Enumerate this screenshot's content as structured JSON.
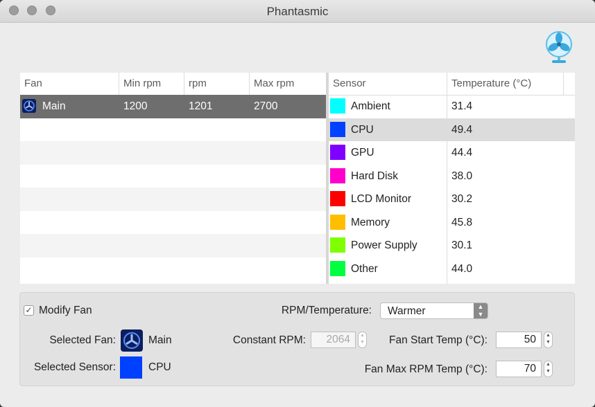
{
  "window": {
    "title": "Phantasmic"
  },
  "fan_table": {
    "columns": [
      "Fan",
      "Min rpm",
      "rpm",
      "Max rpm"
    ],
    "rows": [
      {
        "name": "Main",
        "min_rpm": "1200",
        "rpm": "1201",
        "max_rpm": "2700"
      }
    ]
  },
  "sensor_table": {
    "columns": [
      "Sensor",
      "Temperature (°C)"
    ],
    "rows": [
      {
        "name": "Ambient",
        "temp": "31.4",
        "color": "#00ffff"
      },
      {
        "name": "CPU",
        "temp": "49.4",
        "color": "#0040ff"
      },
      {
        "name": "GPU",
        "temp": "44.4",
        "color": "#8000ff"
      },
      {
        "name": "Hard Disk",
        "temp": "38.0",
        "color": "#ff00cc"
      },
      {
        "name": "LCD Monitor",
        "temp": "30.2",
        "color": "#ff0000"
      },
      {
        "name": "Memory",
        "temp": "45.8",
        "color": "#ffbf00"
      },
      {
        "name": "Power Supply",
        "temp": "30.1",
        "color": "#80ff00"
      },
      {
        "name": "Other",
        "temp": "44.0",
        "color": "#00ff40"
      }
    ]
  },
  "controls": {
    "modify_fan_label": "Modify Fan",
    "modify_fan_checked": true,
    "selected_fan_label": "Selected Fan:",
    "selected_fan_value": "Main",
    "selected_sensor_label": "Selected Sensor:",
    "selected_sensor_value": "CPU",
    "selected_sensor_color": "#0040ff",
    "rpm_temp_label": "RPM/Temperature:",
    "rpm_temp_value": "Warmer",
    "constant_rpm_label": "Constant RPM:",
    "constant_rpm_value": "2064",
    "fan_start_temp_label": "Fan Start Temp (°C):",
    "fan_start_temp_value": "50",
    "fan_max_rpm_temp_label": "Fan Max RPM Temp (°C):",
    "fan_max_rpm_temp_value": "70"
  }
}
